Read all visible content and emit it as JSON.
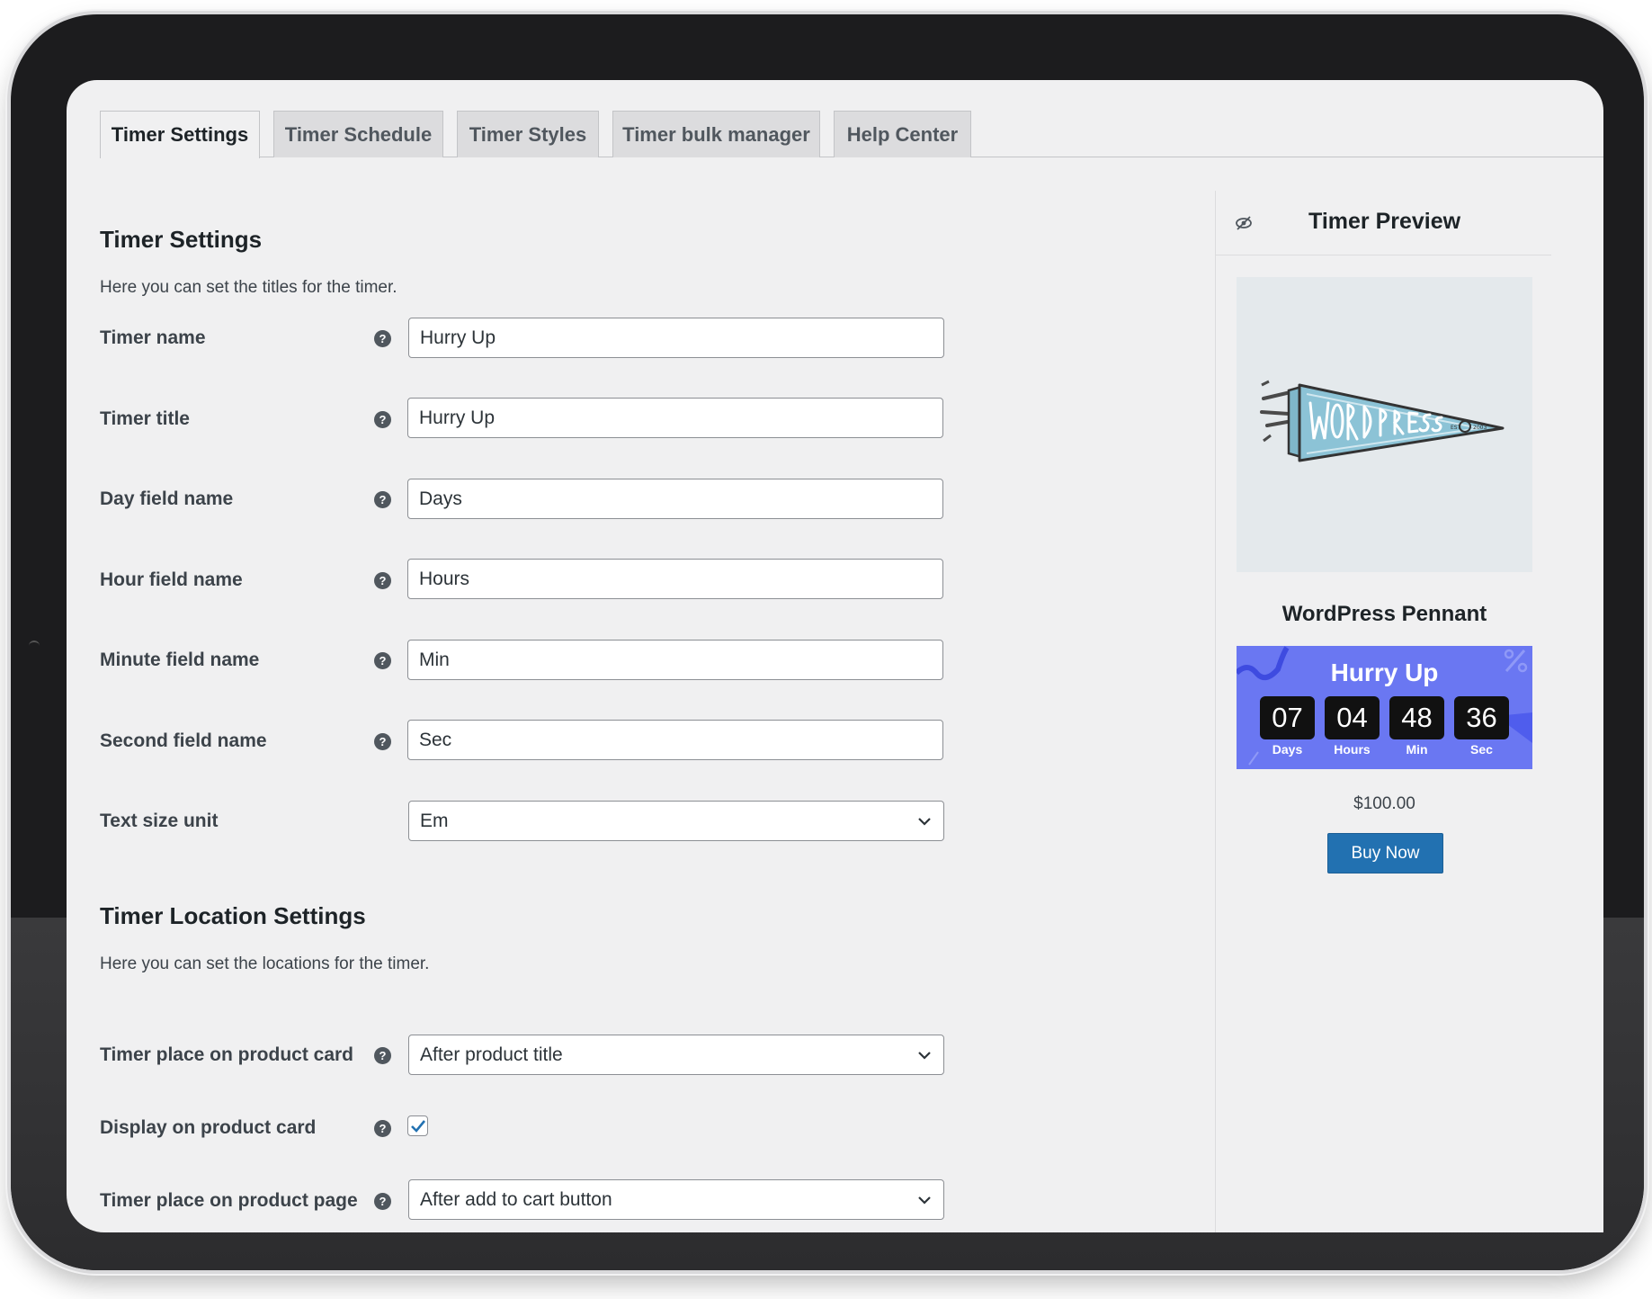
{
  "tabs": [
    {
      "label": "Timer Settings",
      "active": true
    },
    {
      "label": "Timer Schedule",
      "active": false
    },
    {
      "label": "Timer Styles",
      "active": false
    },
    {
      "label": "Timer bulk manager",
      "active": false
    },
    {
      "label": "Help Center",
      "active": false
    }
  ],
  "timer_settings": {
    "heading": "Timer Settings",
    "description": "Here you can set the titles for the timer.",
    "fields": [
      {
        "label": "Timer name",
        "value": "Hurry Up"
      },
      {
        "label": "Timer title",
        "value": "Hurry Up"
      },
      {
        "label": "Day field name",
        "value": "Days"
      },
      {
        "label": "Hour field name",
        "value": "Hours"
      },
      {
        "label": "Minute field name",
        "value": "Min"
      },
      {
        "label": "Second field name",
        "value": "Sec"
      }
    ],
    "text_size_unit": {
      "label": "Text size unit",
      "value": "Em"
    }
  },
  "location_settings": {
    "heading": "Timer Location Settings",
    "description": "Here you can set the locations for the timer.",
    "product_card_place": {
      "label": "Timer place on product card",
      "value": "After product title"
    },
    "display_on_card": {
      "label": "Display on product card",
      "checked": true
    },
    "product_page_place": {
      "label": "Timer place on product page",
      "value": "After add to cart button"
    }
  },
  "help_icon_glyph": "?",
  "preview": {
    "title": "Timer Preview",
    "image_icon": "wordpress-pennant-image",
    "product_name": "WordPress Pennant",
    "timer": {
      "title": "Hurry Up",
      "units": [
        {
          "value": "07",
          "label": "Days"
        },
        {
          "value": "04",
          "label": "Hours"
        },
        {
          "value": "48",
          "label": "Min"
        },
        {
          "value": "36",
          "label": "Sec"
        }
      ],
      "background_color": "#6a77f2"
    },
    "price": "$100.00",
    "buy_label": "Buy Now"
  },
  "colors": {
    "accent": "#2271b1",
    "page_bg": "#f0f0f1"
  }
}
